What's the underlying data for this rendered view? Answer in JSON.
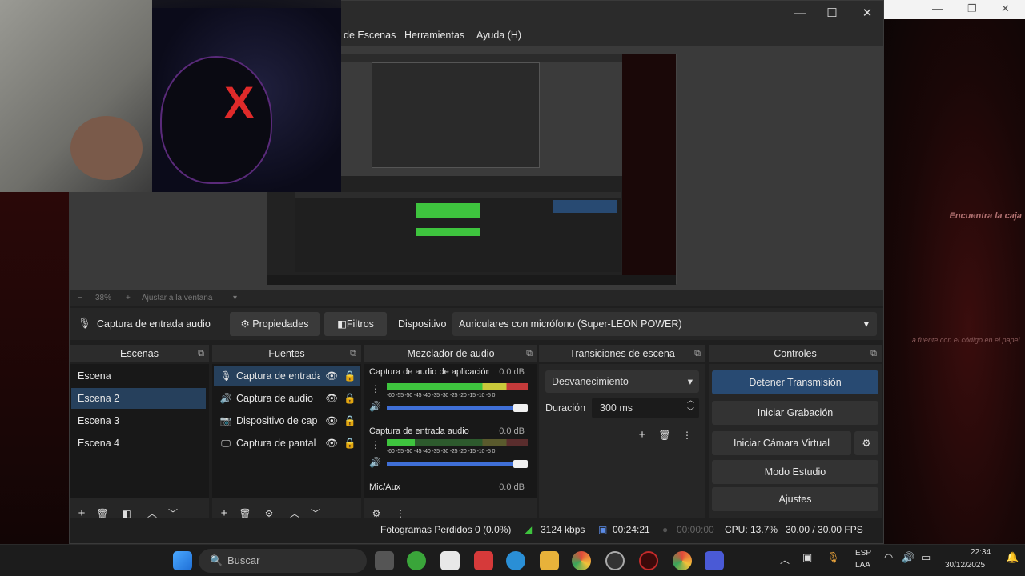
{
  "browser": {
    "minimize": "—",
    "restore": "❐",
    "close": "✕"
  },
  "side_panel": {
    "title": "Encuentra la caja",
    "caption": "...a fuente con el código en el papel."
  },
  "window": {
    "minimize": "—",
    "maximize": "☐",
    "close": "✕"
  },
  "menu": [
    "de Escenas",
    "Herramientas",
    "Ayuda (H)"
  ],
  "zoom": {
    "minus": "−",
    "level": "38%",
    "plus": "+",
    "fit": "Ajustar a la ventana",
    "arrow": "▾"
  },
  "context_bar": {
    "source_name": "Captura de entrada audio",
    "properties": "Propiedades",
    "filters": "Filtros",
    "device_label": "Dispositivo",
    "device_value": "Auriculares con micrófono (Super-LEON POWER)"
  },
  "docks": {
    "scenes": "Escenas",
    "sources": "Fuentes",
    "mixer": "Mezclador de audio",
    "transitions": "Transiciones de escena",
    "controls": "Controles"
  },
  "scenes": [
    "Escena",
    "Escena 2",
    "Escena 3",
    "Escena 4"
  ],
  "sources": [
    {
      "label": "Captura de entrada",
      "icon": "mic-icon"
    },
    {
      "label": "Captura de audio",
      "icon": "speaker-icon"
    },
    {
      "label": "Dispositivo de cap",
      "icon": "camera-icon"
    },
    {
      "label": "Captura de pantal",
      "icon": "monitor-icon"
    }
  ],
  "mixer": [
    {
      "name": "Captura de audio de aplicación (B",
      "db": "0.0 dB",
      "level": 0.98,
      "volume": 1.0
    },
    {
      "name": "Captura de entrada audio",
      "db": "0.0 dB",
      "level": 0.25,
      "volume": 1.0
    },
    {
      "name": "Mic/Aux",
      "db": "0.0 dB"
    }
  ],
  "meter_ticks": "-60 -55 -50 -45 -40 -35 -30 -25 -20 -15 -10 -5 0",
  "transitions": {
    "type": "Desvanecimiento",
    "duration_label": "Duración",
    "duration_value": "300 ms"
  },
  "controls": [
    "Detener Transmisión",
    "Iniciar Grabación",
    "Iniciar Cámara Virtual",
    "Modo Estudio",
    "Ajustes"
  ],
  "status": {
    "dropped": "Fotogramas Perdidos 0 (0.0%)",
    "bitrate": "3124 kbps",
    "stream_time": "00:24:21",
    "rec_time": "00:00:00",
    "cpu": "CPU: 13.7%",
    "fps": "30.00 / 30.00 FPS"
  },
  "taskbar": {
    "search": "Buscar",
    "lang_top": "ESP",
    "lang_bottom": "LAA",
    "time": "22:34",
    "date": "30/12/2025"
  },
  "colors": {
    "accent": "#284a72",
    "selection": "#26405c",
    "meter_green": "#3ec43e",
    "meter_red": "#c43a3a"
  }
}
